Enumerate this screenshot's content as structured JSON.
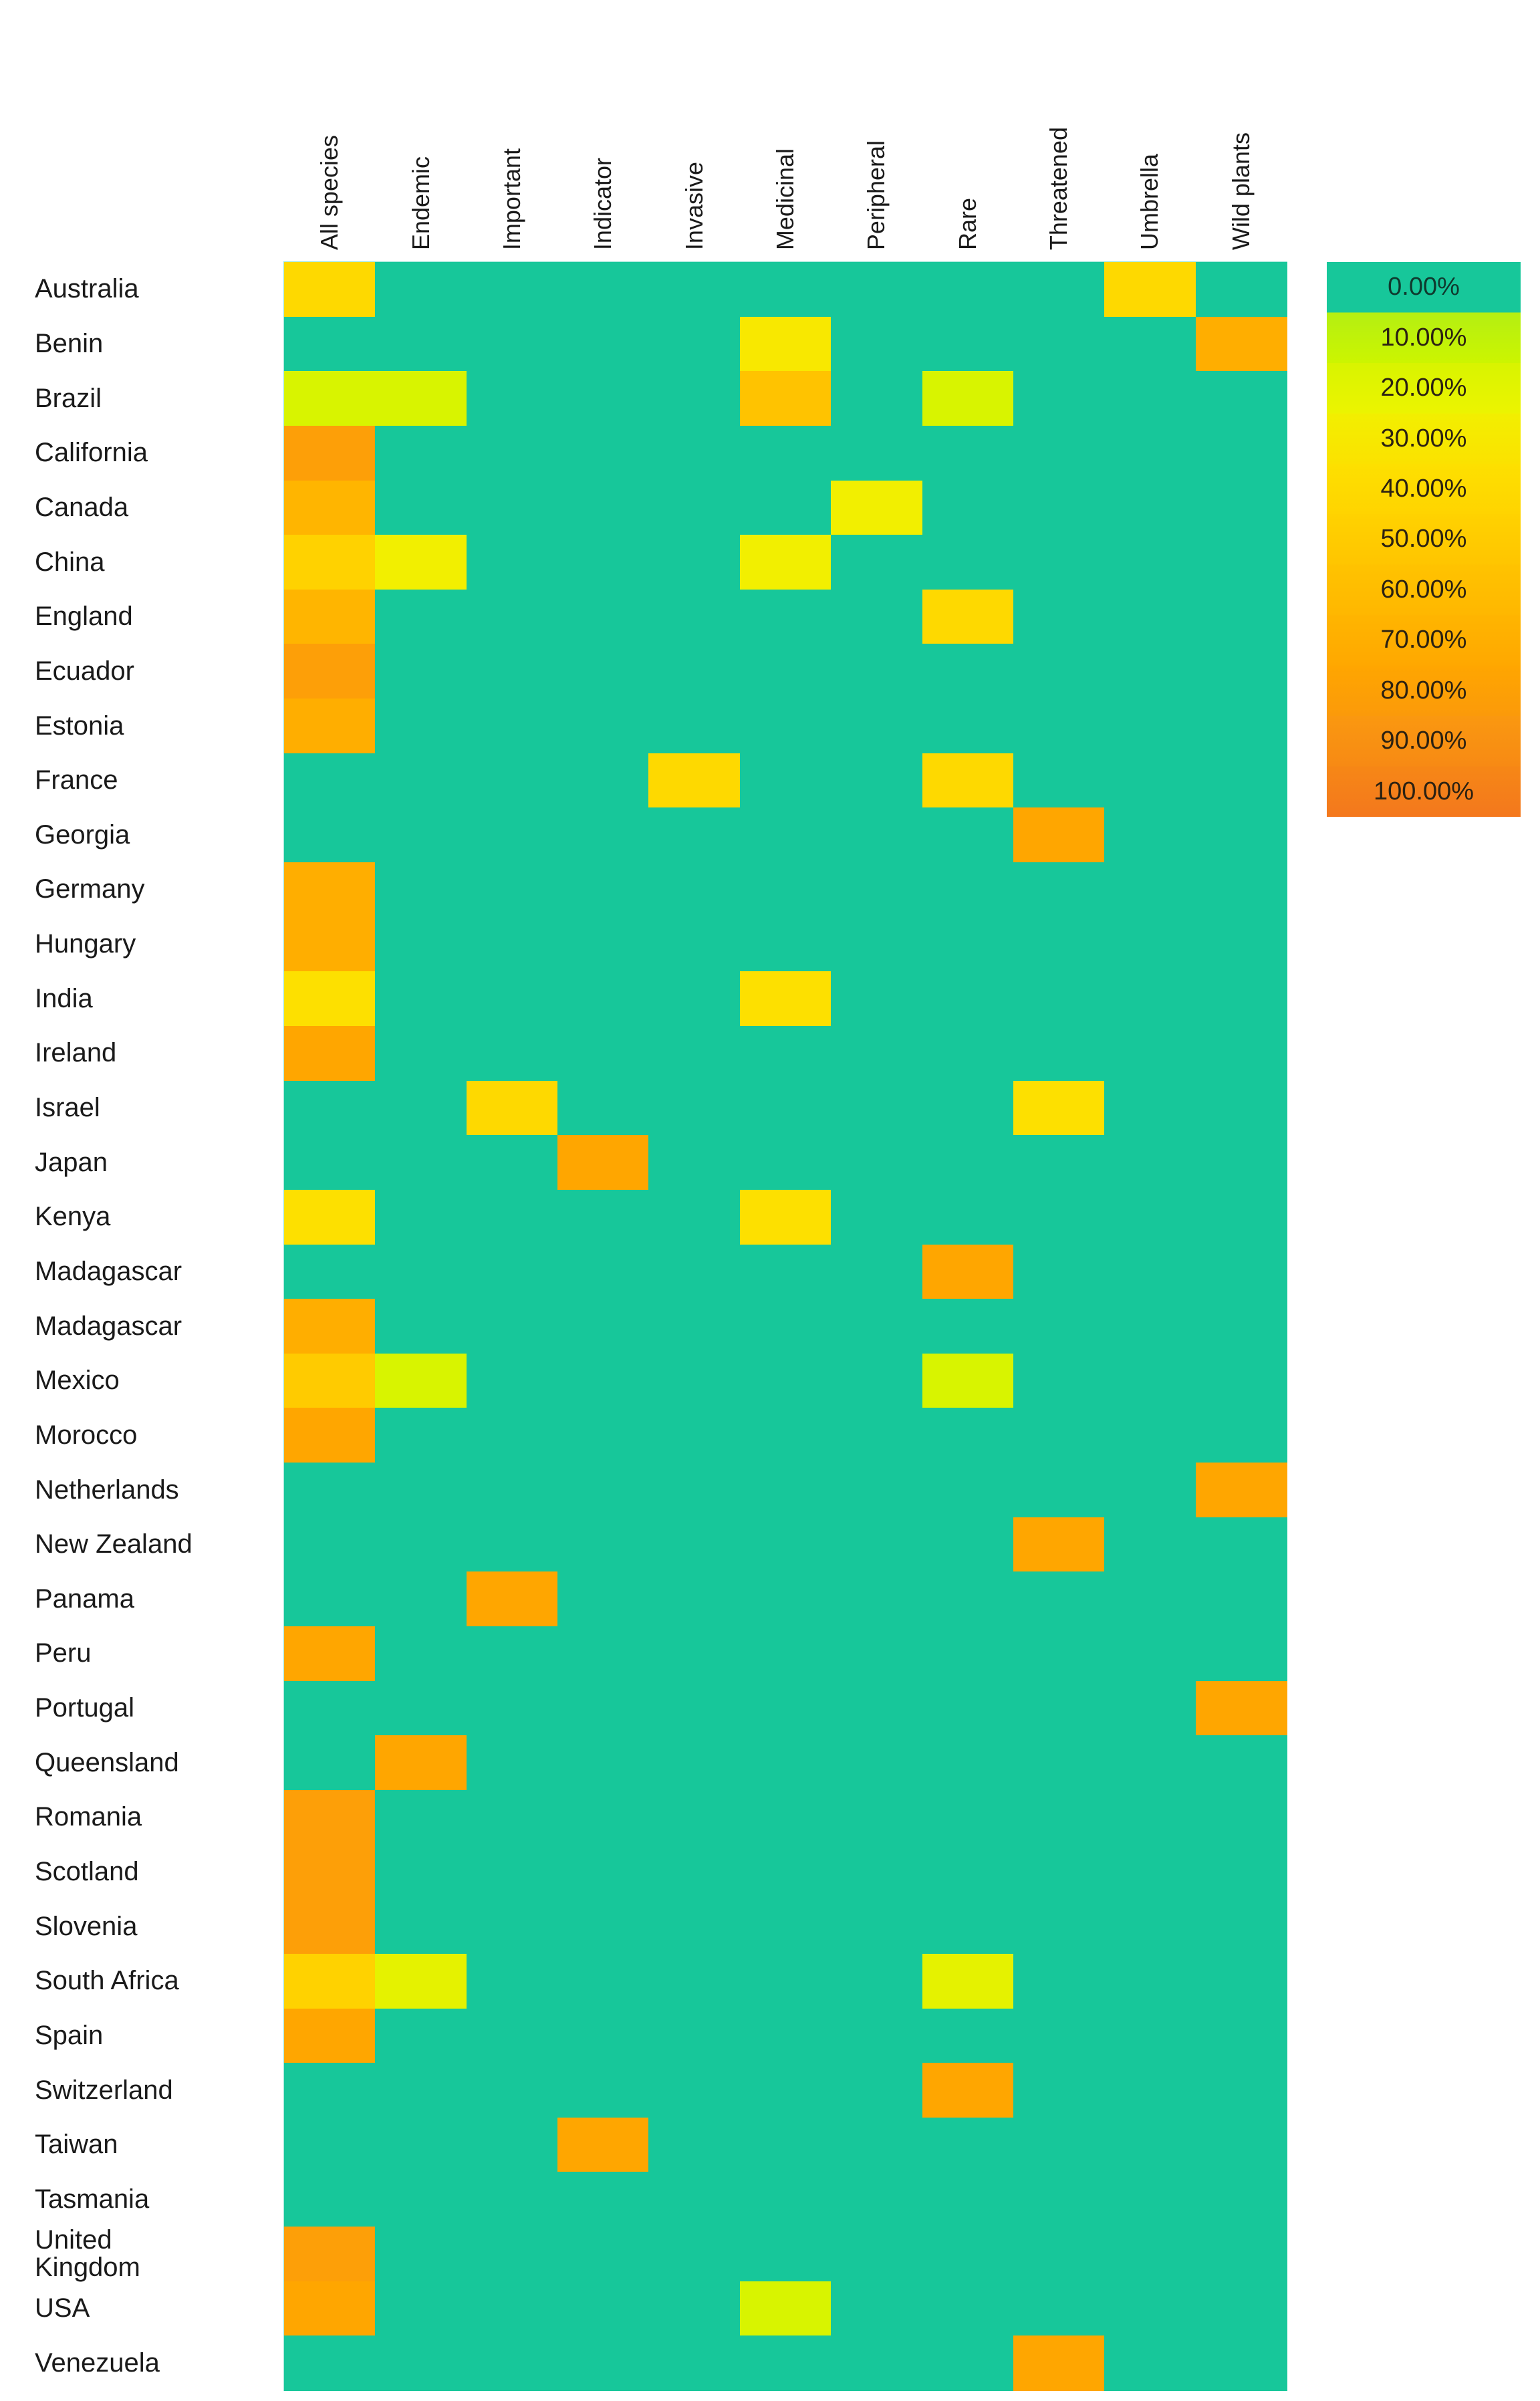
{
  "chart_data": {
    "type": "heatmap",
    "title": "",
    "xlabel": "",
    "ylabel": "",
    "grid": false,
    "legend_position": "right",
    "value_unit": "%",
    "value_range": [
      0,
      100
    ],
    "columns": [
      "All species",
      "Endemic",
      "Important",
      "Indicator",
      "Invasive",
      "Medicinal",
      "Peripheral",
      "Rare",
      "Threatened",
      "Umbrella",
      "Wild plants"
    ],
    "rows": [
      "Australia",
      "Benin",
      "Brazil",
      "California",
      "Canada",
      "China",
      "England",
      "Ecuador",
      "Estonia",
      "France",
      "Georgia",
      "Germany",
      "Hungary",
      "India",
      "Ireland",
      "Israel",
      "Japan",
      "Kenya",
      "Madagascar",
      "Madagascar",
      "Mexico",
      "Morocco",
      "Netherlands",
      "New Zealand",
      "Panama",
      "Peru",
      "Portugal",
      "Queensland",
      "Romania",
      "Scotland",
      "Slovenia",
      "South Africa",
      "Spain",
      "Switzerland",
      "Taiwan",
      "Tasmania",
      "United Kingdom",
      "USA",
      "Venezuela"
    ],
    "row_display": [
      "Australia",
      "Benin",
      "Brazil",
      "California",
      "Canada",
      "China",
      "England",
      "Ecuador",
      "Estonia",
      "France",
      "Georgia",
      "Germany",
      "Hungary",
      "India",
      "Ireland",
      "Israel",
      "Japan",
      "Kenya",
      "Madagascar",
      "Madagascar",
      "Mexico",
      "Morocco",
      "Netherlands",
      "New Zealand",
      "Panama",
      "Peru",
      "Portugal",
      "Queensland",
      "Romania",
      "Scotland",
      "Slovenia",
      "South Africa",
      "Spain",
      "Switzerland",
      "Taiwan",
      "Tasmania",
      "United\nKingdom",
      "USA",
      "Venezuela"
    ],
    "values": [
      [
        45,
        0,
        0,
        0,
        0,
        0,
        0,
        0,
        0,
        45,
        0
      ],
      [
        0,
        0,
        0,
        0,
        0,
        35,
        0,
        0,
        0,
        0,
        75
      ],
      [
        20,
        20,
        0,
        0,
        0,
        60,
        0,
        20,
        0,
        0,
        0
      ],
      [
        85,
        0,
        0,
        0,
        0,
        0,
        0,
        0,
        0,
        0,
        0
      ],
      [
        70,
        0,
        0,
        0,
        0,
        0,
        30,
        0,
        0,
        0,
        0
      ],
      [
        50,
        30,
        0,
        0,
        0,
        30,
        0,
        0,
        0,
        0,
        0
      ],
      [
        70,
        0,
        0,
        0,
        0,
        0,
        0,
        45,
        0,
        0,
        0
      ],
      [
        85,
        0,
        0,
        0,
        0,
        0,
        0,
        0,
        0,
        0,
        0
      ],
      [
        75,
        0,
        0,
        0,
        0,
        0,
        0,
        0,
        0,
        0,
        0
      ],
      [
        0,
        0,
        0,
        0,
        45,
        0,
        0,
        45,
        0,
        0,
        0
      ],
      [
        0,
        0,
        0,
        0,
        0,
        0,
        0,
        0,
        80,
        0,
        0
      ],
      [
        75,
        0,
        0,
        0,
        0,
        0,
        0,
        0,
        0,
        0,
        0
      ],
      [
        75,
        0,
        0,
        0,
        0,
        0,
        0,
        0,
        0,
        0,
        0
      ],
      [
        40,
        0,
        0,
        0,
        0,
        40,
        0,
        0,
        0,
        0,
        0
      ],
      [
        80,
        0,
        0,
        0,
        0,
        0,
        0,
        0,
        0,
        0,
        0
      ],
      [
        0,
        0,
        45,
        0,
        0,
        0,
        0,
        0,
        40,
        0,
        0
      ],
      [
        0,
        0,
        0,
        80,
        0,
        0,
        0,
        0,
        0,
        0,
        0
      ],
      [
        40,
        0,
        0,
        0,
        0,
        40,
        0,
        0,
        0,
        0,
        0
      ],
      [
        0,
        0,
        0,
        0,
        0,
        0,
        0,
        80,
        0,
        0,
        0
      ],
      [
        75,
        0,
        0,
        0,
        0,
        0,
        0,
        0,
        0,
        0,
        0
      ],
      [
        55,
        20,
        0,
        0,
        0,
        0,
        0,
        20,
        0,
        0,
        0
      ],
      [
        80,
        0,
        0,
        0,
        0,
        0,
        0,
        0,
        0,
        0,
        0
      ],
      [
        0,
        0,
        0,
        0,
        0,
        0,
        0,
        0,
        0,
        0,
        80
      ],
      [
        0,
        0,
        0,
        0,
        0,
        0,
        0,
        0,
        80,
        0,
        0
      ],
      [
        0,
        0,
        80,
        0,
        0,
        0,
        0,
        0,
        0,
        0,
        0
      ],
      [
        80,
        0,
        0,
        0,
        0,
        0,
        0,
        0,
        0,
        0,
        0
      ],
      [
        0,
        0,
        0,
        0,
        0,
        0,
        0,
        0,
        0,
        0,
        80
      ],
      [
        0,
        80,
        0,
        0,
        0,
        0,
        0,
        0,
        0,
        0,
        0
      ],
      [
        85,
        0,
        0,
        0,
        0,
        0,
        0,
        0,
        0,
        0,
        0
      ],
      [
        85,
        0,
        0,
        0,
        0,
        0,
        0,
        0,
        0,
        0,
        0
      ],
      [
        85,
        0,
        0,
        0,
        0,
        0,
        0,
        0,
        0,
        0,
        0
      ],
      [
        50,
        25,
        0,
        0,
        0,
        0,
        0,
        25,
        0,
        0,
        0
      ],
      [
        80,
        0,
        0,
        0,
        0,
        0,
        0,
        0,
        0,
        0,
        0
      ],
      [
        0,
        0,
        0,
        0,
        0,
        0,
        0,
        80,
        0,
        0,
        0
      ],
      [
        0,
        0,
        0,
        80,
        0,
        0,
        0,
        0,
        0,
        0,
        0
      ],
      [
        0,
        0,
        0,
        0,
        0,
        0,
        0,
        0,
        0,
        0,
        0
      ],
      [
        85,
        0,
        0,
        0,
        0,
        0,
        0,
        0,
        0,
        0,
        0
      ],
      [
        80,
        0,
        0,
        0,
        0,
        20,
        0,
        0,
        0,
        0,
        0
      ],
      [
        0,
        0,
        0,
        0,
        0,
        0,
        0,
        0,
        80,
        0,
        0
      ]
    ]
  },
  "legend": {
    "labels": [
      "0.00%",
      "10.00%",
      "20.00%",
      "30.00%",
      "40.00%",
      "50.00%",
      "60.00%",
      "70.00%",
      "80.00%",
      "90.00%",
      "100.00%"
    ]
  },
  "colors": {
    "zero": "#17c79a",
    "low": "#c6f200",
    "mid": "#ffd400",
    "high": "#ffa200",
    "max": "#f4781d",
    "text": "#1a1a1a",
    "background": "#ffffff"
  }
}
